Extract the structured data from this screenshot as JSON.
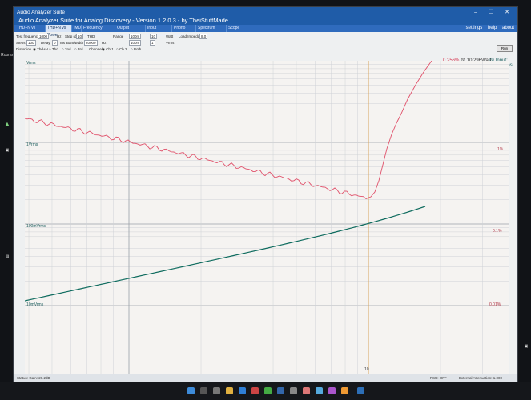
{
  "app": {
    "title": "Audio Analyzer Suite",
    "subtitle": "Audio Analyzer Suite for Analog Discovery - Version   1.2.0.3   - by TheiStuffMade",
    "window_controls": "– ☐ ✕"
  },
  "top_links": [
    "settings",
    "help",
    "about"
  ],
  "tabs": [
    {
      "label": "THD+N vs Frequency",
      "active": false
    },
    {
      "label": "THD+N vs Power",
      "active": true
    },
    {
      "label": "IMD",
      "active": false
    },
    {
      "label": "Frequency Response",
      "active": false
    },
    {
      "label": "Output Impedance",
      "active": false
    },
    {
      "label": "Input Impedance",
      "active": false
    },
    {
      "label": "Phono Stage",
      "active": false
    },
    {
      "label": "Spectrum Analyzer",
      "active": false
    },
    {
      "label": "Scope",
      "active": false
    }
  ],
  "controls": {
    "test_frequency_label": "Test frequency",
    "test_frequency_value": "1000",
    "test_frequency_unit": "Hz",
    "step_label": "Step (d)",
    "step_value": "10",
    "thd_label": "THD",
    "range_label": "Range",
    "range_from": "100m",
    "range_to": "10",
    "range_unit": "Watt",
    "load_label": "Load Impedance",
    "load_value": "8.0",
    "steps_label": "Steps",
    "steps_value": "100",
    "delay_label": "Delay",
    "delay_value": "0",
    "delay_unit": "ms",
    "bandwidth_label": "Bandwidth",
    "bandwidth_value": "20000",
    "bandwidth_unit": "Hz",
    "vrange_from": "100m",
    "vrange_to": "1",
    "vrange_unit": "Vrms",
    "distortion_label": "Distortion",
    "distortion_options": [
      "Thd+N",
      "Thd",
      "2nd",
      "3rd"
    ],
    "channel_label": "Channel",
    "channel_options": [
      "Ch 1",
      "Ch 2",
      "Both"
    ],
    "run_button": "Run"
  },
  "readouts": {
    "thd": "0.256%",
    "power": "@ 10.296Watt",
    "input": "@ Input: 2.000Vrms"
  },
  "axis_left": [
    "1Vrms",
    "100mVrms",
    "10mVrms"
  ],
  "axis_right": [
    "1%",
    "0.1%",
    "0.01%"
  ],
  "x_tick": "10",
  "status": {
    "left": "Status: Gain: 26.2dB",
    "middle": "PSU: OFF",
    "right": "External Attenuation: 1.000"
  },
  "colors": {
    "thd_trace": "#e0506a",
    "voltage_trace": "#0e6b5e",
    "marker": "#e3a24a",
    "title_bar": "#1f5ca8"
  }
}
